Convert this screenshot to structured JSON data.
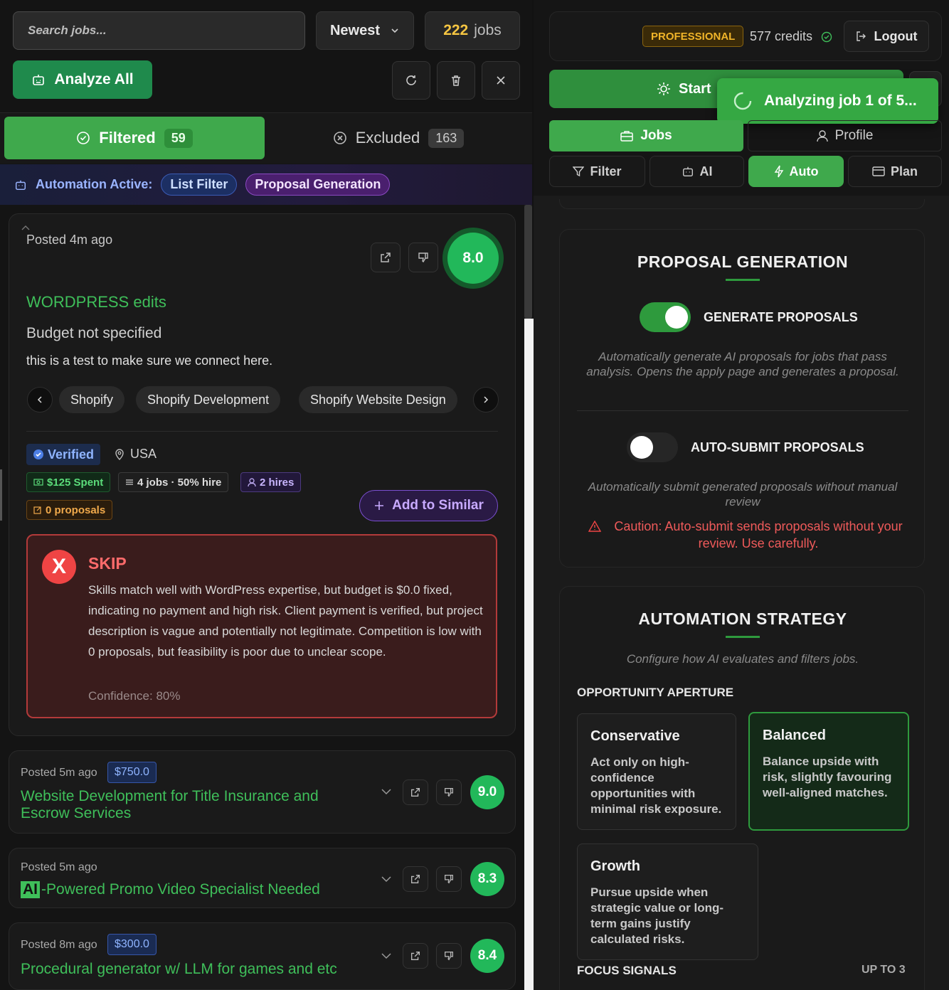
{
  "search": {
    "placeholder": "Search jobs..."
  },
  "sort": {
    "label": "Newest"
  },
  "jobs_count": {
    "number": "222",
    "suffix": "jobs"
  },
  "analyze_all": "Analyze All",
  "tabs": {
    "filtered": {
      "label": "Filtered",
      "count": "59"
    },
    "excluded": {
      "label": "Excluded",
      "count": "163"
    }
  },
  "automation": {
    "label": "Automation Active:",
    "pills": [
      "List Filter",
      "Proposal Generation"
    ]
  },
  "expanded_job": {
    "posted": "Posted 4m ago",
    "score": "8.0",
    "title": "WORDPRESS edits",
    "budget": "Budget not specified",
    "description": "this is a test to make sure we connect here.",
    "skills": [
      "Shopify",
      "Shopify Development",
      "Shopify Website Design"
    ],
    "verified": "Verified",
    "country": "USA",
    "spent": "$125 Spent",
    "jobs_hire": "4 jobs · 50% hire",
    "hires": "2 hires",
    "proposals": "0 proposals",
    "add_similar": "Add to Similar",
    "verdict": {
      "label": "SKIP",
      "mark": "X",
      "text": "Skills match well with WordPress expertise, but budget is $0.0 fixed, indicating no payment and high risk. Client payment is verified, but project description is vague and potentially not legitimate. Competition is low with 0 proposals, but feasibility is poor due to unclear scope.",
      "confidence": "Confidence: 80%"
    }
  },
  "job_list": [
    {
      "posted": "Posted 5m ago",
      "budget": "$750.0",
      "title": "Website Development for Title Insurance and Escrow Services",
      "score": "9.0"
    },
    {
      "posted": "Posted 5m ago",
      "budget": "",
      "title_ai": "AI",
      "title": "-Powered Promo Video Specialist Needed",
      "score": "8.3"
    },
    {
      "posted": "Posted 8m ago",
      "budget": "$300.0",
      "title": "Procedural generator w/ LLM for games and etc",
      "score": "8.4"
    }
  ],
  "header_right": {
    "plan": "PROFESSIONAL",
    "credits": "577 credits",
    "logout": "Logout"
  },
  "start_label": "Start",
  "toast": "Analyzing job 1 of 5...",
  "nav": {
    "jobs": "Jobs",
    "profile": "Profile"
  },
  "subnav": {
    "filter": "Filter",
    "ai": "AI",
    "auto": "Auto",
    "plan": "Plan"
  },
  "proposal": {
    "title": "PROPOSAL GENERATION",
    "generate": {
      "label": "GENERATE PROPOSALS",
      "desc": "Automatically generate AI proposals for jobs that pass analysis. Opens the apply page and generates a proposal."
    },
    "submit": {
      "label": "AUTO-SUBMIT PROPOSALS",
      "desc": "Automatically submit generated proposals without manual review"
    },
    "caution": "Caution: Auto-submit sends proposals without your review. Use carefully."
  },
  "strategy": {
    "title": "AUTOMATION STRATEGY",
    "subtitle": "Configure how AI evaluates and filters jobs.",
    "aperture": "OPPORTUNITY APERTURE",
    "options": [
      {
        "name": "Conservative",
        "desc": "Act only on high-confidence opportunities with minimal risk exposure."
      },
      {
        "name": "Balanced",
        "desc": "Balance upside with risk, slightly favouring well-aligned matches."
      },
      {
        "name": "Growth",
        "desc": "Pursue upside when strategic value or long-term gains justify calculated risks."
      }
    ],
    "focus": "FOCUS SIGNALS",
    "up_to": "UP TO 3"
  },
  "colors": {
    "accent": "#3fa94c",
    "score": "#22b85a",
    "skip": "#ef4444",
    "pro": "#f0b429",
    "automation": "#9ab4ff"
  }
}
